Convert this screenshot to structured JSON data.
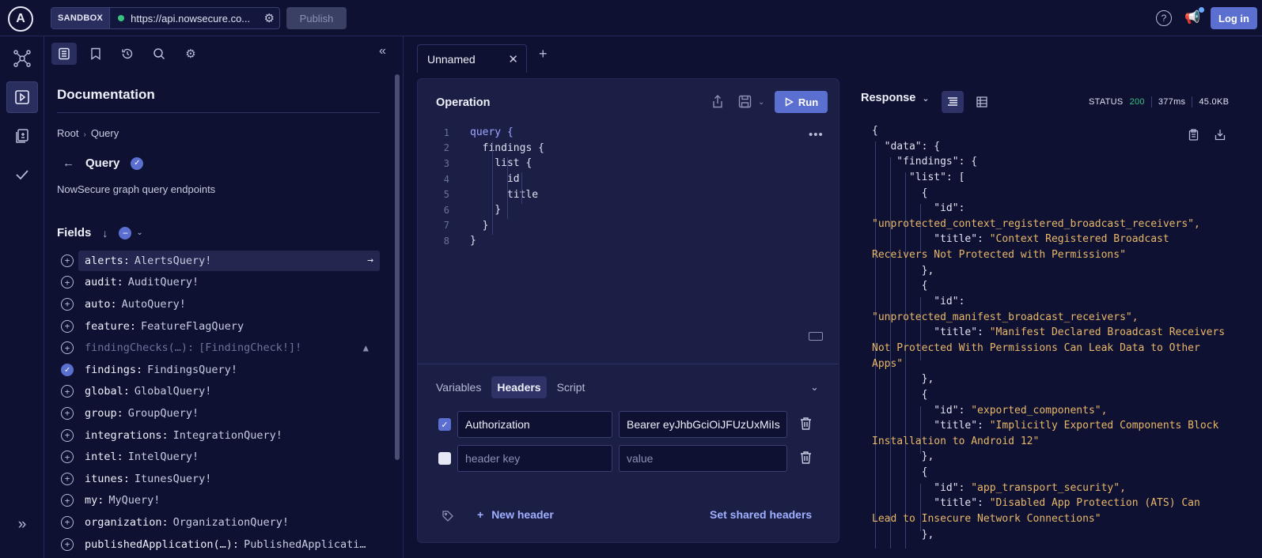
{
  "topbar": {
    "logo": "A",
    "env_tag": "SANDBOX",
    "endpoint_url": "https://api.nowsecure.co...",
    "publish_label": "Publish",
    "help": "?",
    "login_label": "Log in"
  },
  "docs": {
    "title": "Documentation",
    "breadcrumb": [
      "Root",
      "Query"
    ],
    "query_name": "Query",
    "query_description": "NowSecure graph query endpoints",
    "fields_label": "Fields",
    "fields": [
      {
        "name": "alerts:",
        "type": "AlertsQuery!",
        "state": "highlight"
      },
      {
        "name": "audit:",
        "type": "AuditQuery!",
        "state": "normal"
      },
      {
        "name": "auto:",
        "type": "AutoQuery!",
        "state": "normal"
      },
      {
        "name": "feature:",
        "type": "FeatureFlagQuery",
        "state": "normal"
      },
      {
        "name": "findingChecks(…):",
        "type": "[FindingCheck!]!",
        "state": "deprecated"
      },
      {
        "name": "findings:",
        "type": "FindingsQuery!",
        "state": "selected"
      },
      {
        "name": "global:",
        "type": "GlobalQuery!",
        "state": "normal"
      },
      {
        "name": "group:",
        "type": "GroupQuery!",
        "state": "normal"
      },
      {
        "name": "integrations:",
        "type": "IntegrationQuery!",
        "state": "normal"
      },
      {
        "name": "intel:",
        "type": "IntelQuery!",
        "state": "normal"
      },
      {
        "name": "itunes:",
        "type": "ItunesQuery!",
        "state": "normal"
      },
      {
        "name": "my:",
        "type": "MyQuery!",
        "state": "normal"
      },
      {
        "name": "organization:",
        "type": "OrganizationQuery!",
        "state": "normal"
      },
      {
        "name": "publishedApplication(…):",
        "type": "PublishedApplicati…",
        "state": "normal"
      }
    ]
  },
  "tabs": [
    {
      "label": "Unnamed"
    }
  ],
  "operation": {
    "title": "Operation",
    "run_label": "Run",
    "code_lines": [
      {
        "n": "1",
        "text": "query {"
      },
      {
        "n": "2",
        "text": "  findings {"
      },
      {
        "n": "3",
        "text": "    list {"
      },
      {
        "n": "4",
        "text": "      id"
      },
      {
        "n": "5",
        "text": "      title"
      },
      {
        "n": "6",
        "text": "    }"
      },
      {
        "n": "7",
        "text": "  }"
      },
      {
        "n": "8",
        "text": "}"
      }
    ],
    "subtabs": [
      "Variables",
      "Headers",
      "Script"
    ],
    "active_subtab": "Headers",
    "headers": [
      {
        "enabled": true,
        "key": "Authorization",
        "value": "Bearer eyJhbGciOiJFUzUxMiIs"
      },
      {
        "enabled": false,
        "key_placeholder": "header key",
        "value_placeholder": "value"
      }
    ],
    "new_header_label": "New header",
    "shared_headers_label": "Set shared headers"
  },
  "response": {
    "title": "Response",
    "status_label": "STATUS",
    "status_code": "200",
    "time": "377ms",
    "size": "45.0KB",
    "json_lines": [
      "{",
      "  \"data\": {",
      "    \"findings\": {",
      "      \"list\": [",
      "        {",
      "          \"id\":",
      "\"unprotected_context_registered_broadcast_receivers\",",
      "          \"title\": \"Context Registered Broadcast",
      "Receivers Not Protected with Permissions\"",
      "        },",
      "        {",
      "          \"id\":",
      "\"unprotected_manifest_broadcast_receivers\",",
      "          \"title\": \"Manifest Declared Broadcast Receivers",
      "Not Protected With Permissions Can Leak Data to Other",
      "Apps\"",
      "        },",
      "        {",
      "          \"id\": \"exported_components\",",
      "          \"title\": \"Implicitly Exported Components Block",
      "Installation to Android 12\"",
      "        },",
      "        {",
      "          \"id\": \"app_transport_security\",",
      "          \"title\": \"Disabled App Protection (ATS) Can",
      "Lead to Insecure Network Connections\"",
      "        },"
    ]
  },
  "colors": {
    "background": "#0f1133",
    "card": "#1b1e45",
    "accent": "#5b6fd1",
    "string": "#e8b868",
    "success": "#36c47f"
  }
}
